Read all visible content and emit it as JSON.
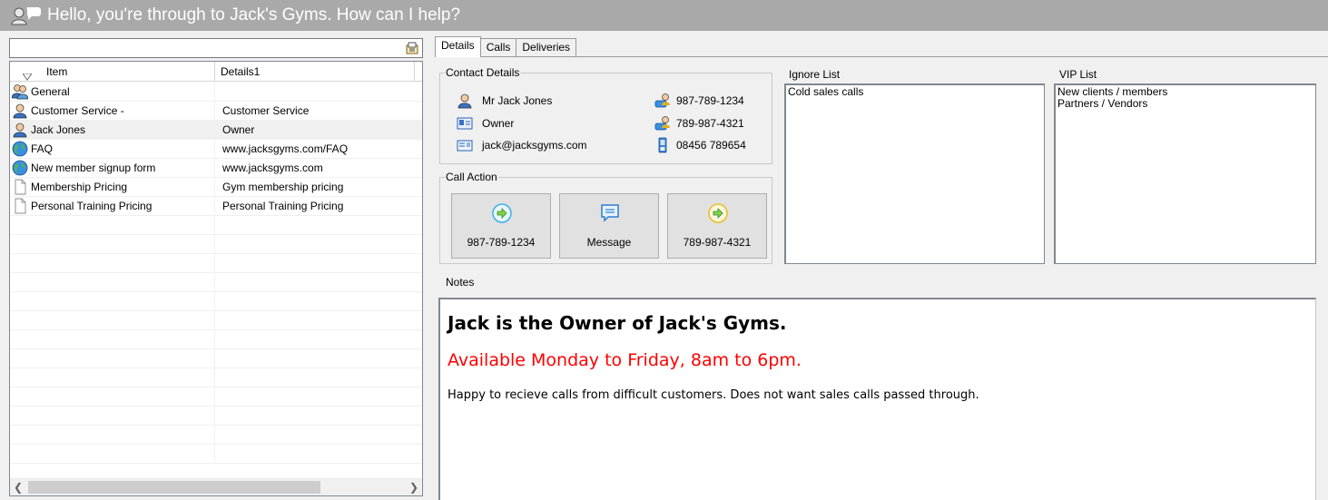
{
  "window": {
    "title": "Hello, you're through to Jack's Gyms. How can I help?",
    "title_icon": "operator-chat-icon"
  },
  "search": {
    "value": "",
    "icon": "directory-search-icon"
  },
  "list": {
    "columns": [
      "Item",
      "Details1"
    ],
    "rows": [
      {
        "item": "General",
        "details": "",
        "icon": "group-icon"
      },
      {
        "item": "Customer Service -",
        "details": "Customer Service",
        "icon": "person-icon"
      },
      {
        "item": "Jack Jones",
        "details": "Owner",
        "icon": "person-icon"
      },
      {
        "item": "FAQ",
        "details": "www.jacksgyms.com/FAQ",
        "icon": "globe-icon"
      },
      {
        "item": "New member signup form",
        "details": "www.jacksgyms.com",
        "icon": "globe-icon"
      },
      {
        "item": "Membership Pricing",
        "details": "Gym membership pricing",
        "icon": "document-icon"
      },
      {
        "item": "Personal Training Pricing",
        "details": "Personal Training Pricing",
        "icon": "document-icon"
      }
    ],
    "selected_index": 2
  },
  "tabs": [
    "Details",
    "Calls",
    "Deliveries"
  ],
  "active_tab": "Details",
  "contact_details": {
    "legend": "Contact Details",
    "name": "Mr Jack Jones",
    "role": "Owner",
    "email": "jack@jacksgyms.com",
    "phone1": "987-789-1234",
    "phone2": "789-987-4321",
    "mobile": "08456 789654"
  },
  "call_action": {
    "legend": "Call Action",
    "buttons": [
      {
        "label": "987-789-1234",
        "icon": "forward-call-icon",
        "color": "#3cb0e8"
      },
      {
        "label": "Message",
        "icon": "message-icon",
        "color": "#2a7fd0"
      },
      {
        "label": "789-987-4321",
        "icon": "forward-call-icon",
        "color": "#e8c020"
      }
    ]
  },
  "ignore_list": {
    "label": "Ignore List",
    "items": [
      "Cold sales calls"
    ]
  },
  "vip_list": {
    "label": "VIP List",
    "items": [
      "New clients / members",
      "Partners / Vendors"
    ]
  },
  "notes": {
    "label": "Notes",
    "heading": "Jack is the Owner of Jack's Gyms.",
    "availability": "Available Monday to Friday, 8am to 6pm.",
    "body": "Happy to recieve calls from difficult customers. Does not want sales calls passed through.",
    "availability_color": "#ff0000"
  }
}
